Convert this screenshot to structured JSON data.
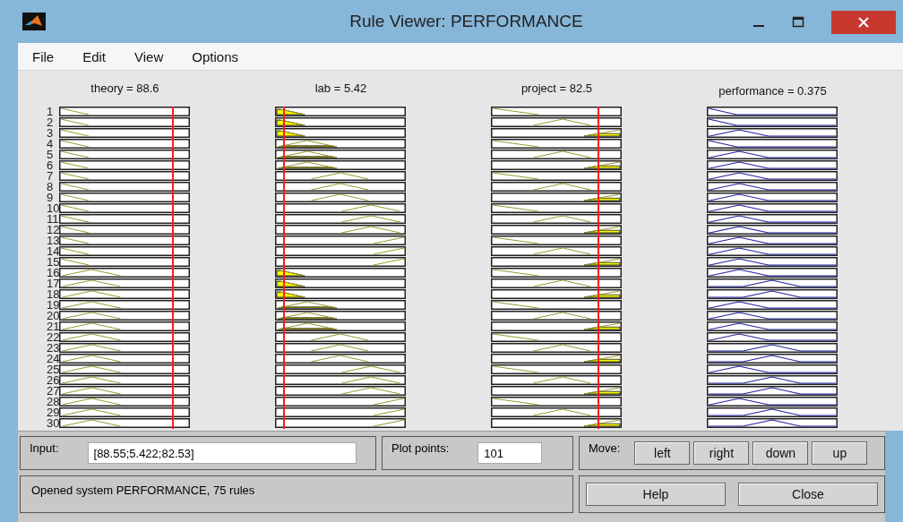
{
  "window": {
    "title": "Rule Viewer: PERFORMANCE"
  },
  "menu": [
    "File",
    "Edit",
    "View",
    "Options"
  ],
  "rule_numbers": [
    "1",
    "2",
    "3",
    "4",
    "5",
    "6",
    "7",
    "8",
    "9",
    "10",
    "11",
    "12",
    "13",
    "14",
    "15",
    "16",
    "17",
    "18",
    "19",
    "20",
    "21",
    "22",
    "23",
    "24",
    "25",
    "26",
    "27",
    "28",
    "29",
    "30"
  ],
  "variables": [
    {
      "label": "theory = 88.6",
      "kind": "input",
      "rules": [
        {
          "kind": "z"
        },
        {
          "kind": "z"
        },
        {
          "kind": "z"
        },
        {
          "kind": "z"
        },
        {
          "kind": "z"
        },
        {
          "kind": "z"
        },
        {
          "kind": "z"
        },
        {
          "kind": "z"
        },
        {
          "kind": "z"
        },
        {
          "kind": "z"
        },
        {
          "kind": "z"
        },
        {
          "kind": "z"
        },
        {
          "kind": "z"
        },
        {
          "kind": "z"
        },
        {
          "kind": "z"
        },
        {
          "kind": "t1"
        },
        {
          "kind": "t1"
        },
        {
          "kind": "t1"
        },
        {
          "kind": "t1"
        },
        {
          "kind": "t1"
        },
        {
          "kind": "t1"
        },
        {
          "kind": "t1"
        },
        {
          "kind": "t1"
        },
        {
          "kind": "t1"
        },
        {
          "kind": "t1"
        },
        {
          "kind": "t1"
        },
        {
          "kind": "t1"
        },
        {
          "kind": "t1"
        },
        {
          "kind": "t1"
        },
        {
          "kind": "t1"
        }
      ]
    },
    {
      "label": "lab = 5.42",
      "kind": "input",
      "rules": [
        {
          "kind": "z"
        },
        {
          "kind": "z"
        },
        {
          "kind": "z"
        },
        {
          "kind": "t1"
        },
        {
          "kind": "t1"
        },
        {
          "kind": "t1"
        },
        {
          "kind": "t2"
        },
        {
          "kind": "t2"
        },
        {
          "kind": "t2"
        },
        {
          "kind": "t3"
        },
        {
          "kind": "t3"
        },
        {
          "kind": "t3"
        },
        {
          "kind": "s"
        },
        {
          "kind": "s"
        },
        {
          "kind": "s"
        },
        {
          "kind": "z"
        },
        {
          "kind": "z"
        },
        {
          "kind": "z"
        },
        {
          "kind": "t1"
        },
        {
          "kind": "t1"
        },
        {
          "kind": "t1"
        },
        {
          "kind": "t2"
        },
        {
          "kind": "t2"
        },
        {
          "kind": "t2"
        },
        {
          "kind": "t3"
        },
        {
          "kind": "t3"
        },
        {
          "kind": "t3"
        },
        {
          "kind": "s"
        },
        {
          "kind": "s"
        },
        {
          "kind": "s"
        }
      ]
    },
    {
      "label": "project = 82.5",
      "kind": "input",
      "rules": [
        {
          "kind": "zw"
        },
        {
          "kind": "tm"
        },
        {
          "kind": "sw"
        },
        {
          "kind": "zw"
        },
        {
          "kind": "tm"
        },
        {
          "kind": "sw"
        },
        {
          "kind": "zw"
        },
        {
          "kind": "tm"
        },
        {
          "kind": "sw"
        },
        {
          "kind": "zw"
        },
        {
          "kind": "tm"
        },
        {
          "kind": "sw"
        },
        {
          "kind": "zw"
        },
        {
          "kind": "tm"
        },
        {
          "kind": "sw"
        },
        {
          "kind": "zw"
        },
        {
          "kind": "tm"
        },
        {
          "kind": "sw"
        },
        {
          "kind": "zw"
        },
        {
          "kind": "tm"
        },
        {
          "kind": "sw"
        },
        {
          "kind": "zw"
        },
        {
          "kind": "tm"
        },
        {
          "kind": "sw"
        },
        {
          "kind": "zw"
        },
        {
          "kind": "tm"
        },
        {
          "kind": "sw"
        },
        {
          "kind": "zw"
        },
        {
          "kind": "tm"
        },
        {
          "kind": "sw"
        }
      ]
    },
    {
      "label": "performance = 0.375",
      "kind": "output",
      "rules": [
        {
          "kind": "z"
        },
        {
          "kind": "z"
        },
        {
          "kind": "t1"
        },
        {
          "kind": "z"
        },
        {
          "kind": "t1"
        },
        {
          "kind": "t1"
        },
        {
          "kind": "t1"
        },
        {
          "kind": "t1"
        },
        {
          "kind": "t1"
        },
        {
          "kind": "t1"
        },
        {
          "kind": "t1"
        },
        {
          "kind": "t1"
        },
        {
          "kind": "t1"
        },
        {
          "kind": "t1"
        },
        {
          "kind": "t1"
        },
        {
          "kind": "t1"
        },
        {
          "kind": "t2"
        },
        {
          "kind": "t2"
        },
        {
          "kind": "t1"
        },
        {
          "kind": "t1"
        },
        {
          "kind": "t1"
        },
        {
          "kind": "t1"
        },
        {
          "kind": "t2"
        },
        {
          "kind": "t2"
        },
        {
          "kind": "t1"
        },
        {
          "kind": "t2"
        },
        {
          "kind": "t2"
        },
        {
          "kind": "t1"
        },
        {
          "kind": "t2"
        },
        {
          "kind": "t2"
        }
      ]
    }
  ],
  "input": {
    "label": "Input:",
    "value": "[88.55;5.422;82.53]"
  },
  "plot_points": {
    "label": "Plot points:",
    "value": "101"
  },
  "move": {
    "label": "Move:",
    "buttons": [
      "left",
      "right",
      "down",
      "up"
    ]
  },
  "status": "Opened system PERFORMANCE, 75 rules",
  "buttons": [
    "Help",
    "Close"
  ]
}
